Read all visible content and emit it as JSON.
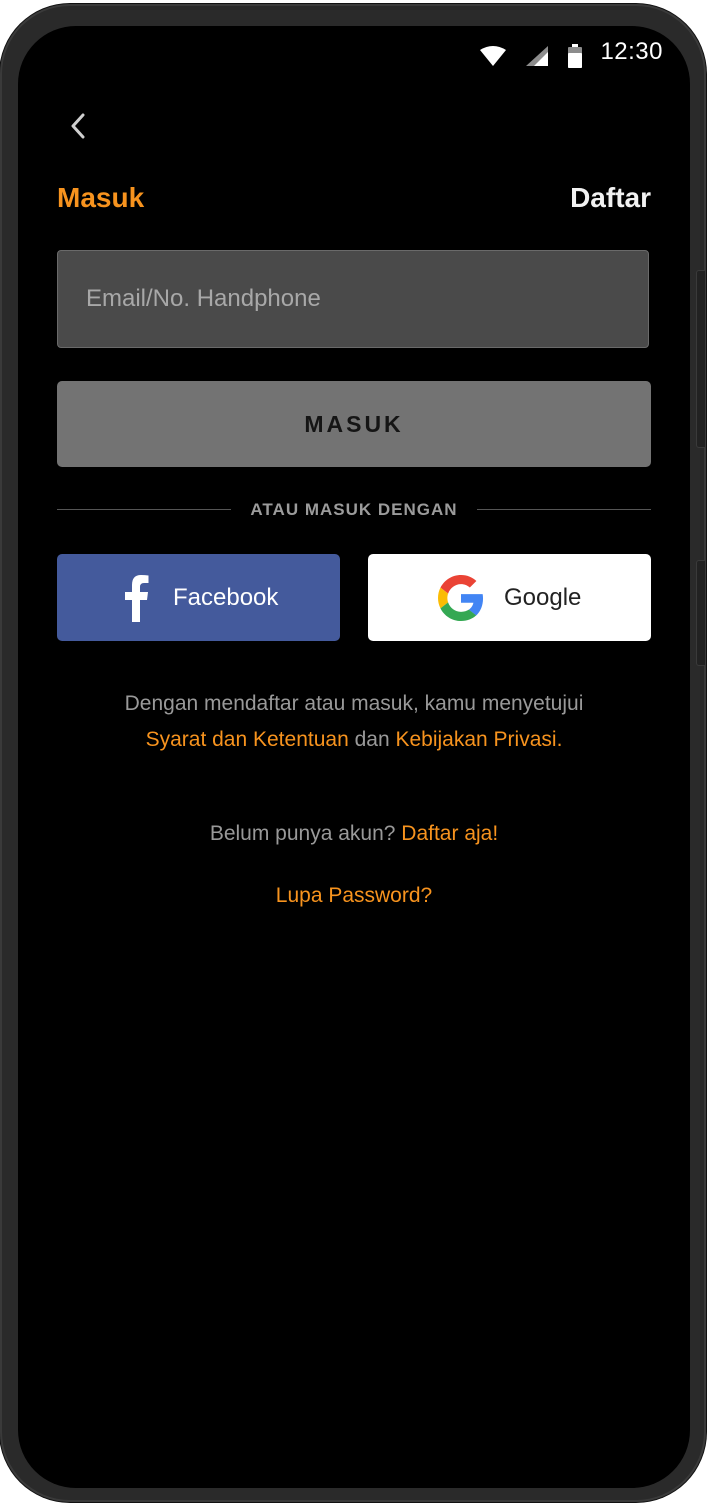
{
  "status_bar": {
    "time": "12:30",
    "icons": [
      "wifi-icon",
      "signal-icon",
      "battery-icon"
    ]
  },
  "header": {
    "back_icon": "chevron-left-icon",
    "tab_login": "Masuk",
    "tab_register": "Daftar"
  },
  "form": {
    "email_placeholder": "Email/No. Handphone",
    "email_value": "",
    "submit_label": "MASUK"
  },
  "divider_label": "ATAU MASUK DENGAN",
  "social": {
    "facebook_label": "Facebook",
    "google_label": "Google"
  },
  "terms": {
    "intro": "Dengan mendaftar atau masuk, kamu menyetujui",
    "terms_link": "Syarat dan Ketentuan",
    "connector": "dan",
    "privacy_link": "Kebijakan Privasi."
  },
  "signup": {
    "prompt": "Belum punya akun?",
    "link": "Daftar aja!"
  },
  "forgot_password": "Lupa Password?",
  "colors": {
    "accent": "#f7931e",
    "background": "#000000",
    "facebook": "#445a9c",
    "button_disabled": "#737373",
    "input_bg": "#4a4a4a"
  }
}
